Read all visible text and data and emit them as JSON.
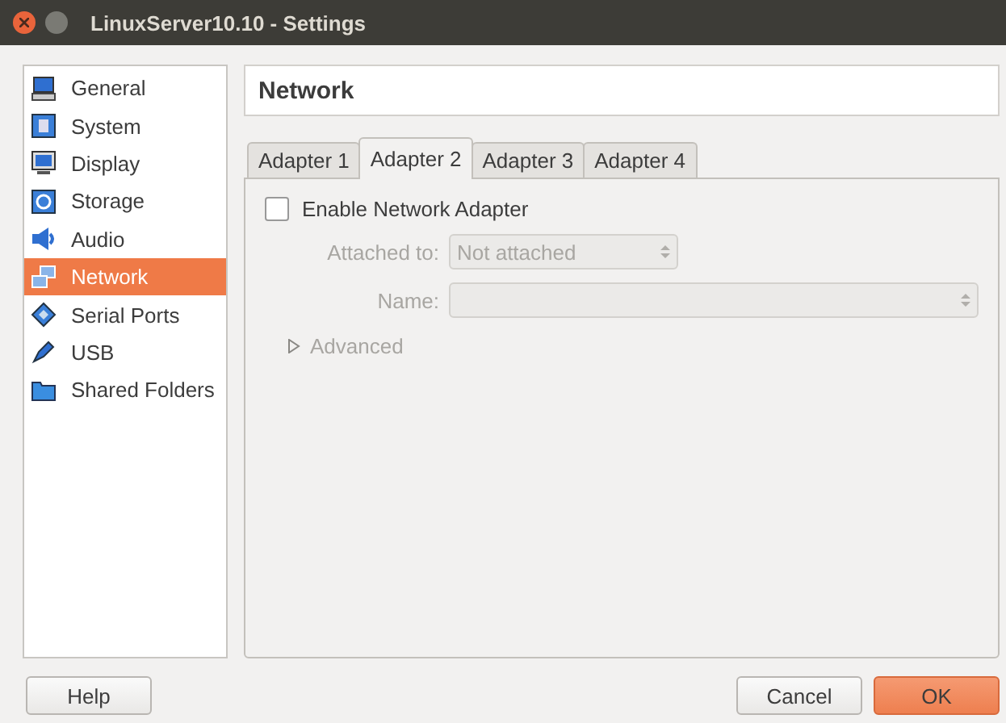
{
  "window": {
    "title": "LinuxServer10.10 - Settings"
  },
  "sidebar": {
    "items": [
      {
        "label": "General",
        "selected": false
      },
      {
        "label": "System",
        "selected": false
      },
      {
        "label": "Display",
        "selected": false
      },
      {
        "label": "Storage",
        "selected": false
      },
      {
        "label": "Audio",
        "selected": false
      },
      {
        "label": "Network",
        "selected": true
      },
      {
        "label": "Serial Ports",
        "selected": false
      },
      {
        "label": "USB",
        "selected": false
      },
      {
        "label": "Shared Folders",
        "selected": false
      }
    ]
  },
  "page": {
    "title": "Network"
  },
  "tabs": [
    {
      "label": "Adapter 1",
      "selected": false
    },
    {
      "label": "Adapter 2",
      "selected": true
    },
    {
      "label": "Adapter 3",
      "selected": false
    },
    {
      "label": "Adapter 4",
      "selected": false
    }
  ],
  "enable": {
    "label": "Enable Network Adapter",
    "checked": false
  },
  "attached": {
    "label": "Attached to:",
    "value": "Not attached",
    "disabled": true
  },
  "name": {
    "label": "Name:",
    "disabled": true
  },
  "advanced": {
    "label": "Advanced",
    "expanded": false,
    "disabled": true
  },
  "buttons": [
    {
      "label": "Help",
      "kind": "plain"
    },
    {
      "label": "Cancel",
      "kind": "plain"
    },
    {
      "label": "OK",
      "kind": "default"
    }
  ]
}
